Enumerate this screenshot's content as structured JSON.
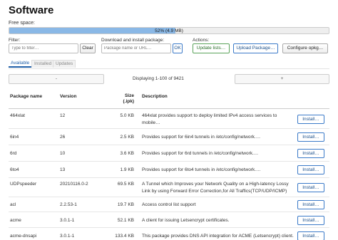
{
  "page": {
    "title": "Software"
  },
  "free_space": {
    "label": "Free space:",
    "text": "52% (4.9 MB)",
    "used_fraction": 0.52
  },
  "filter": {
    "label": "Filter:",
    "placeholder": "Type to filter…",
    "clear_label": "Clear"
  },
  "download": {
    "label": "Download and install package:",
    "placeholder": "Package name or URL…",
    "ok_label": "OK"
  },
  "actions": {
    "label": "Actions:",
    "update_label": "Update lists…",
    "upload_label": "Upload Package…",
    "configure_label": "Configure opkg…"
  },
  "tabs": [
    {
      "label": "Available"
    },
    {
      "label": "Installed"
    },
    {
      "label": "Updates"
    }
  ],
  "pager": {
    "prev_label": "-",
    "text": "Displaying 1-100 of 9421",
    "next_label": "+"
  },
  "table": {
    "headers": {
      "name": "Package name",
      "version": "Version",
      "size": "Size (.ipk)",
      "description": "Description"
    },
    "install_label": "Install…",
    "rows": [
      {
        "name": "464xlat",
        "version": "12",
        "size": "5.0 KB",
        "desc1": "464xlat provides support to deploy limited IPv4 access services to",
        "desc2": "mobile…"
      },
      {
        "name": "6in4",
        "version": "26",
        "size": "2.5 KB",
        "desc1": "Provides support for 6in4 tunnels in /etc/config/network.…",
        "desc2": ""
      },
      {
        "name": "6rd",
        "version": "10",
        "size": "3.6 KB",
        "desc1": "Provides support for 6rd tunnels in /etc/config/network.…",
        "desc2": ""
      },
      {
        "name": "6to4",
        "version": "13",
        "size": "1.9 KB",
        "desc1": "Provides support for 6to4 tunnels in /etc/config/network.…",
        "desc2": ""
      },
      {
        "name": "UDPspeeder",
        "version": "20210116.0-2",
        "size": "69.5 KB",
        "desc1": "A Tunnel which Improves your Network Quality on a High-latency Lossy",
        "desc2": "Link by using Forward Error Correction,for All Traffics(TCP/UDP/ICMP)"
      },
      {
        "name": "acl",
        "version": "2.2.53-1",
        "size": "19.7 KB",
        "desc1": "Access control list support",
        "desc2": ""
      },
      {
        "name": "acme",
        "version": "3.0.1-1",
        "size": "52.1 KB",
        "desc1": "A client for issuing Letsencrypt certificates.",
        "desc2": ""
      },
      {
        "name": "acme-dnsapi",
        "version": "3.0.1-1",
        "size": "133.4 KB",
        "desc1": "This package provides DNS API integration for ACME (Letsencrypt) client.",
        "desc2": ""
      }
    ]
  }
}
